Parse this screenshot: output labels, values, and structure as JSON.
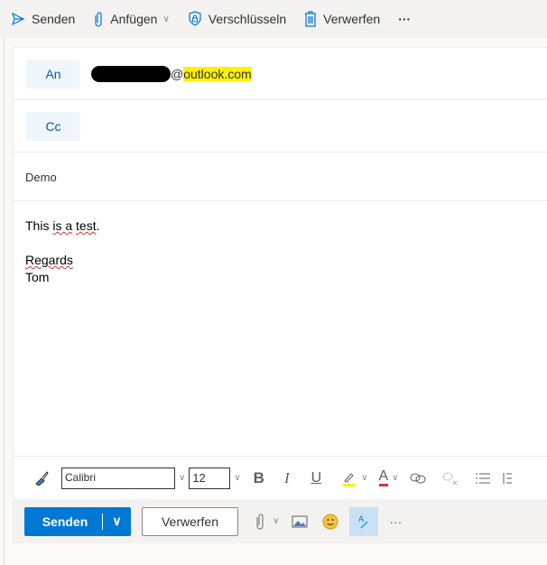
{
  "toolbar": {
    "send": "Senden",
    "attach": "Anfügen",
    "encrypt": "Verschlüsseln",
    "discard": "Verwerfen",
    "more": "···"
  },
  "to": {
    "label": "An",
    "email_prefix": "@",
    "email_domain": "outlook.com"
  },
  "cc": {
    "label": "Cc"
  },
  "subject": "Demo",
  "body": {
    "line1_a": "This ",
    "line1_b": "is a",
    "line1_c": " ",
    "line1_d": "test",
    "line1_e": ".",
    "line2": "Regards",
    "line3": "Tom"
  },
  "format": {
    "font": "Calibri",
    "size": "12",
    "bold": "B",
    "italic": "I",
    "underline": "U",
    "font_color": "A"
  },
  "actions": {
    "send": "Senden",
    "discard": "Verwerfen",
    "more": "···"
  },
  "colors": {
    "accent": "#0078d4",
    "highlight": "#fff100",
    "font_color": "#d13438"
  }
}
